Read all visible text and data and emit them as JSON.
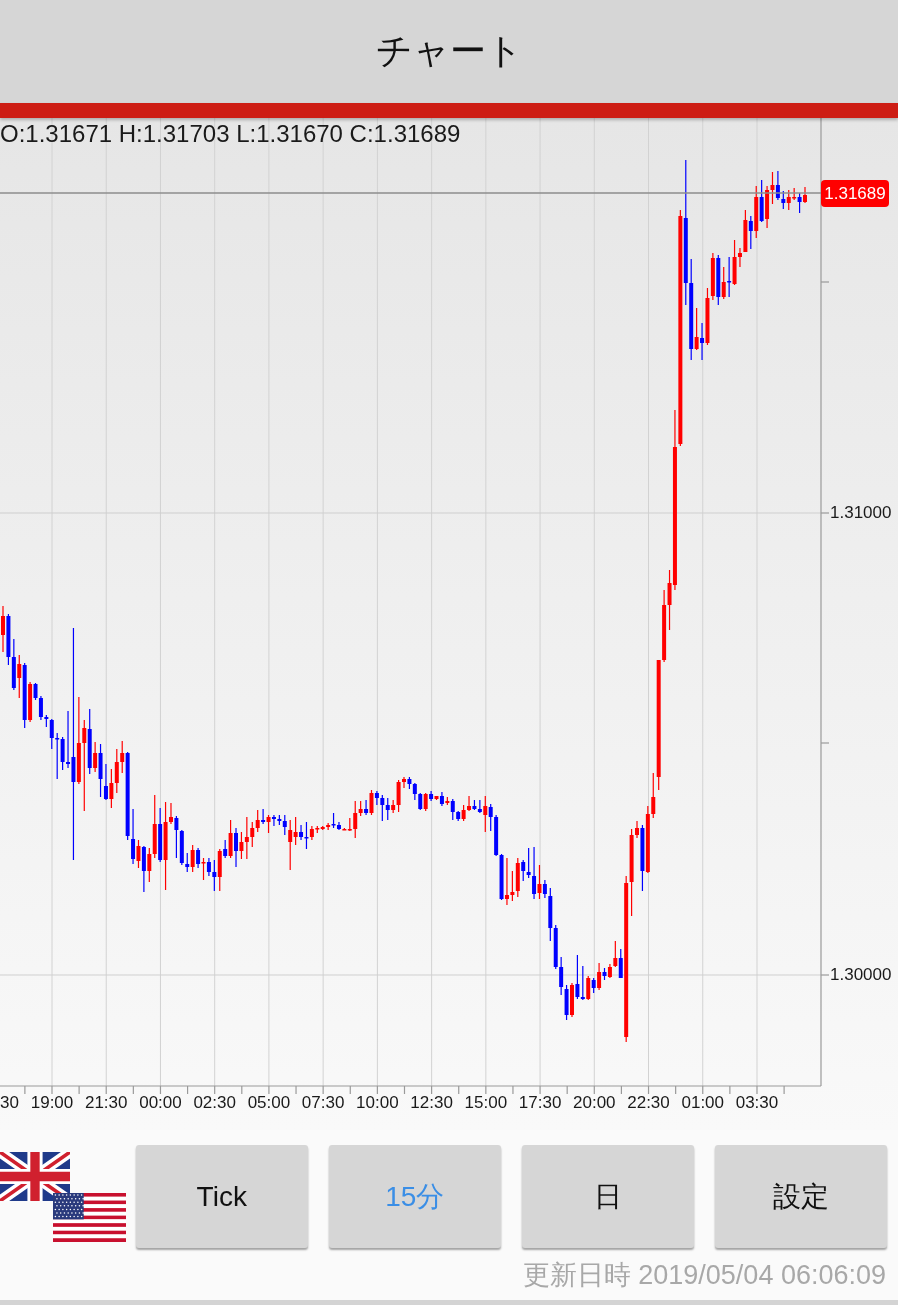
{
  "header": {
    "title": "チャート"
  },
  "chart": {
    "ohlc": "O:1.31671 H:1.31703 L:1.31670 C:1.31689",
    "current_price": "1.31689",
    "y_axis_labels": [
      "1.31000",
      "1.30000"
    ],
    "x_axis_labels": [
      "30",
      "19:00",
      "21:30",
      "00:00",
      "02:30",
      "05:00",
      "07:30",
      "10:00",
      "12:30",
      "15:00",
      "17:30",
      "20:00",
      "22:30",
      "01:00",
      "03:30"
    ]
  },
  "timeframes": [
    {
      "label": "Tick",
      "selected": false
    },
    {
      "label": "15分",
      "selected": true
    },
    {
      "label": "日",
      "selected": false
    }
  ],
  "settings_button": {
    "label": "設定"
  },
  "updated_at": "更新日時 2019/05/04 06:06:09"
}
